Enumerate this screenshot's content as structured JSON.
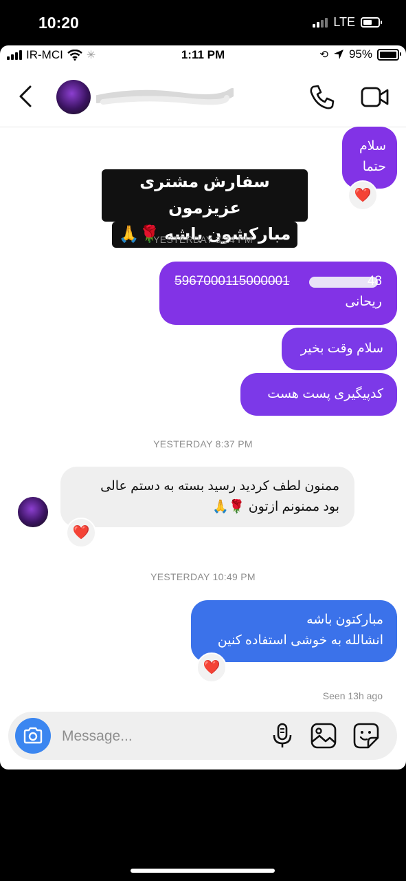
{
  "outer_status": {
    "time": "10:20",
    "network": "LTE"
  },
  "inner_status": {
    "carrier": "IR-MCI",
    "time": "1:11 PM",
    "battery": "95%"
  },
  "header": {
    "contact_name": ""
  },
  "sticker": {
    "line1": "سفارش مشتری عزیزمون",
    "line2": "مبارکشون باشه 🌹🙏"
  },
  "messages": {
    "m1": {
      "line1": "سلام",
      "line2": "حتما",
      "reaction": "❤️"
    },
    "ts1": "YESTERDAY 3:24 PM",
    "m2": {
      "line1": "5967000115000001",
      "line1_tail": "48",
      "line2": "ریحانی"
    },
    "m3": "سلام وقت بخیر",
    "m4": "کدپیگیری پست هست",
    "ts2": "YESTERDAY 8:37 PM",
    "m5": {
      "line1": "ممنون لطف کردید رسید بسته به دستم عالی",
      "line2": "بود ممنونم ازتون 🌹🙏",
      "reaction": "❤️"
    },
    "ts3": "YESTERDAY 10:49 PM",
    "m6": {
      "line1": "مبارکتون باشه",
      "line2": "انشالله به خوشی استفاده کنین",
      "reaction": "❤️"
    },
    "seen": "Seen 13h ago"
  },
  "composer": {
    "placeholder": "Message..."
  },
  "colors": {
    "accent_purple": "#8233e6",
    "accent_blue": "#3b72ea",
    "camera_blue": "#3b86f0"
  }
}
